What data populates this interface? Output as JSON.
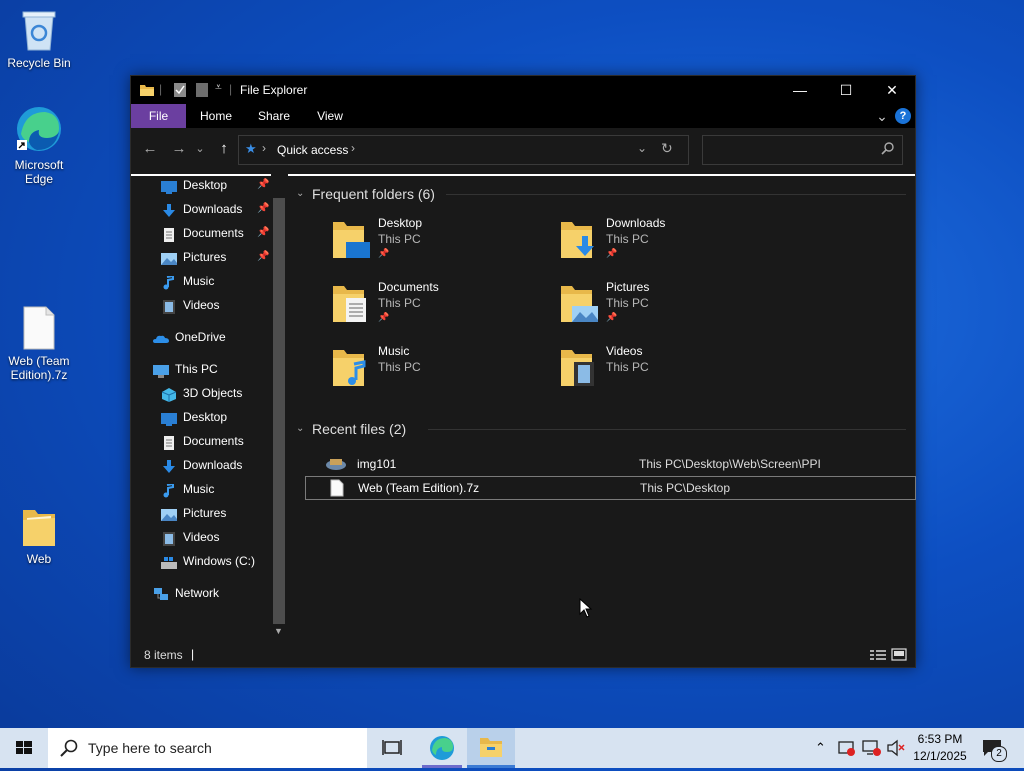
{
  "desktop": {
    "icons": [
      {
        "label": "Recycle Bin",
        "icon": "recycle-bin-icon"
      },
      {
        "label": "Microsoft Edge",
        "icon": "edge-icon"
      },
      {
        "label": "Web (Team Edition).7z",
        "icon": "file-icon"
      },
      {
        "label": "Web",
        "icon": "folder-icon"
      }
    ]
  },
  "window": {
    "title": "File Explorer",
    "minimize": "—",
    "maximize": "☐",
    "close": "✕",
    "ribbon_tabs": [
      "File",
      "Home",
      "Share",
      "View"
    ],
    "help": "?",
    "expand_ribbon": "⌄"
  },
  "navigation": {
    "back": "←",
    "forward": "→",
    "recent": "⌄",
    "up": "↑",
    "address": {
      "location": "Quick access",
      "separator": "›"
    },
    "refresh": "↻",
    "dropdown": "⌄",
    "search_placeholder": ""
  },
  "nav_pane": {
    "quick_access": [
      {
        "label": "Desktop",
        "icon": "desktop-icon",
        "pinned": true
      },
      {
        "label": "Downloads",
        "icon": "downloads-icon",
        "pinned": true
      },
      {
        "label": "Documents",
        "icon": "documents-icon",
        "pinned": true
      },
      {
        "label": "Pictures",
        "icon": "pictures-icon",
        "pinned": true
      },
      {
        "label": "Music",
        "icon": "music-icon",
        "pinned": false
      },
      {
        "label": "Videos",
        "icon": "videos-icon",
        "pinned": false
      }
    ],
    "onedrive": "OneDrive",
    "this_pc": "This PC",
    "this_pc_items": [
      {
        "label": "3D Objects",
        "icon": "3d-objects-icon"
      },
      {
        "label": "Desktop",
        "icon": "desktop-icon"
      },
      {
        "label": "Documents",
        "icon": "documents-icon"
      },
      {
        "label": "Downloads",
        "icon": "downloads-icon"
      },
      {
        "label": "Music",
        "icon": "music-icon"
      },
      {
        "label": "Pictures",
        "icon": "pictures-icon"
      },
      {
        "label": "Videos",
        "icon": "videos-icon"
      },
      {
        "label": "Windows (C:)",
        "icon": "drive-icon"
      }
    ],
    "network": "Network",
    "pin_glyph": "📌"
  },
  "main": {
    "frequent_header": "Frequent folders (6)",
    "frequent": [
      {
        "name": "Desktop",
        "sub": "This PC",
        "pinned": true,
        "icon": "desktop-folder-icon"
      },
      {
        "name": "Downloads",
        "sub": "This PC",
        "pinned": true,
        "icon": "downloads-folder-icon"
      },
      {
        "name": "Documents",
        "sub": "This PC",
        "pinned": true,
        "icon": "documents-folder-icon"
      },
      {
        "name": "Pictures",
        "sub": "This PC",
        "pinned": true,
        "icon": "pictures-folder-icon"
      },
      {
        "name": "Music",
        "sub": "This PC",
        "pinned": false,
        "icon": "music-folder-icon"
      },
      {
        "name": "Videos",
        "sub": "This PC",
        "pinned": false,
        "icon": "videos-folder-icon"
      }
    ],
    "recent_header": "Recent files (2)",
    "recent": [
      {
        "name": "img101",
        "path": "This PC\\Desktop\\Web\\Screen\\PPI",
        "icon": "image-file-icon",
        "selected": false
      },
      {
        "name": "Web (Team Edition).7z",
        "path": "This PC\\Desktop",
        "icon": "file-icon",
        "selected": true
      }
    ]
  },
  "status": {
    "count": "8 items",
    "cursor": "|"
  },
  "taskbar": {
    "search_placeholder": "Type here to search",
    "time": "6:53 PM",
    "date": "12/1/2025",
    "notifications": "2"
  },
  "colors": {
    "accent": "#6b3fa0",
    "selected_border": "#7a7a7a",
    "desktop_blue": "#0d4fc2",
    "taskbar": "#d7e3f1"
  }
}
